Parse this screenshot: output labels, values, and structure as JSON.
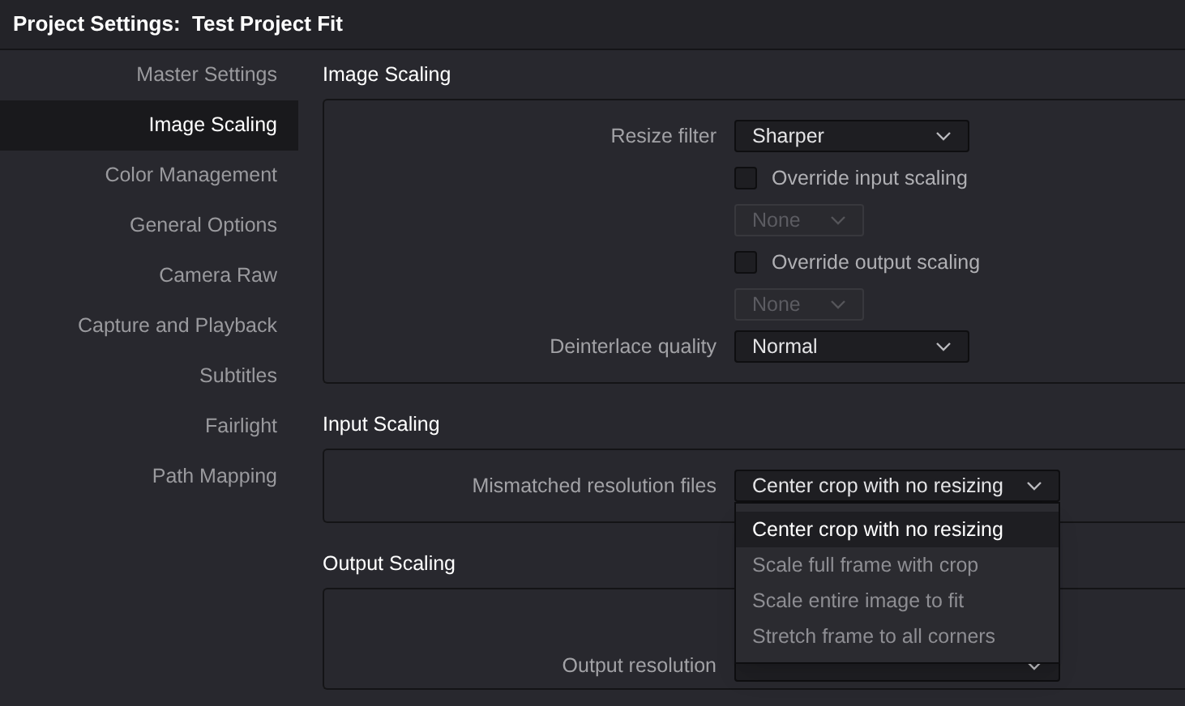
{
  "window": {
    "title": "Project Settings:  Test Project Fit"
  },
  "sidebar": {
    "items": [
      {
        "label": "Master Settings",
        "selected": false
      },
      {
        "label": "Image Scaling",
        "selected": true
      },
      {
        "label": "Color Management",
        "selected": false
      },
      {
        "label": "General Options",
        "selected": false
      },
      {
        "label": "Camera Raw",
        "selected": false
      },
      {
        "label": "Capture and Playback",
        "selected": false
      },
      {
        "label": "Subtitles",
        "selected": false
      },
      {
        "label": "Fairlight",
        "selected": false
      },
      {
        "label": "Path Mapping",
        "selected": false
      }
    ]
  },
  "sections": [
    {
      "title": "Image Scaling",
      "rows": [
        {
          "kind": "select",
          "label": "Resize filter",
          "value": "Sharper",
          "disabled": false
        },
        {
          "kind": "checkbox",
          "label": "Override input scaling",
          "checked": false
        },
        {
          "kind": "select",
          "value": "None",
          "disabled": true
        },
        {
          "kind": "checkbox",
          "label": "Override output scaling",
          "checked": false
        },
        {
          "kind": "select",
          "value": "None",
          "disabled": true
        },
        {
          "kind": "select",
          "label": "Deinterlace quality",
          "value": "Normal",
          "disabled": false
        }
      ]
    },
    {
      "title": "Input Scaling",
      "rows": [
        {
          "kind": "select",
          "label": "Mismatched resolution files",
          "value": "Center crop with no resizing",
          "disabled": false,
          "expanded": true,
          "options": [
            {
              "label": "Center crop with no resizing",
              "selected": true
            },
            {
              "label": "Scale full frame with crop",
              "selected": false
            },
            {
              "label": "Scale entire image to fit",
              "selected": false
            },
            {
              "label": "Stretch frame to all corners",
              "selected": false
            }
          ]
        }
      ]
    },
    {
      "title": "Output Scaling",
      "rows": [
        {
          "kind": "select",
          "label": "Output resolution",
          "disabled": false
        }
      ]
    }
  ]
}
